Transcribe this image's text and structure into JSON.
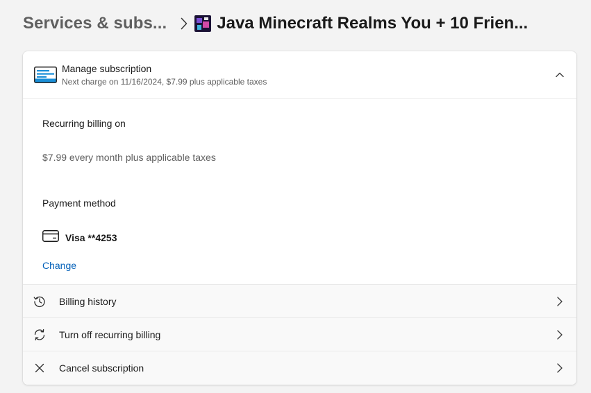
{
  "breadcrumb": {
    "parent": "Services & subs...",
    "current": "Java Minecraft Realms You + 10 Frien...",
    "separator_icon": "chevron-right-icon",
    "product_icon": "minecraft-product-thumbnail"
  },
  "subscription": {
    "title": "Manage subscription",
    "subtitle": "Next charge on 11/16/2024, $7.99 plus applicable taxes",
    "icon": "subscription-card-icon",
    "expanded_icon": "chevron-up-icon"
  },
  "billing": {
    "recurring_label": "Recurring billing on",
    "price_text": "$7.99 every month plus applicable taxes"
  },
  "payment": {
    "label": "Payment method",
    "card_text": "Visa **4253",
    "card_icon": "credit-card-icon",
    "change_label": "Change"
  },
  "actions": [
    {
      "label": "Billing history",
      "icon": "history-icon"
    },
    {
      "label": "Turn off recurring billing",
      "icon": "sync-icon"
    },
    {
      "label": "Cancel subscription",
      "icon": "close-icon"
    }
  ],
  "colors": {
    "background": "#f3f3f3",
    "card": "#ffffff",
    "link": "#005fb8",
    "subscription_icon_accent": "#1a8fd8"
  }
}
